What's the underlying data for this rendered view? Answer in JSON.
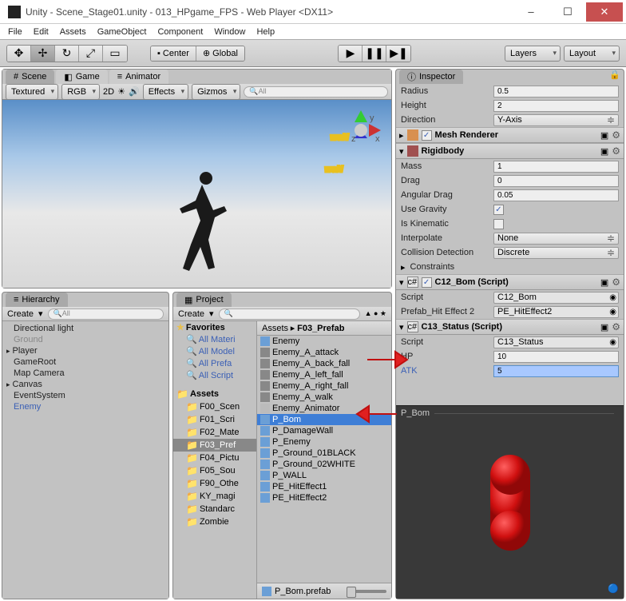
{
  "window": {
    "title": "Unity - Scene_Stage01.unity - 013_HPgame_FPS - Web Player <DX11>"
  },
  "menu": {
    "file": "File",
    "edit": "Edit",
    "assets": "Assets",
    "gameobject": "GameObject",
    "component": "Component",
    "window": "Window",
    "help": "Help"
  },
  "toolbar": {
    "center": "Center",
    "global": "Global",
    "layers": "Layers",
    "layout": "Layout"
  },
  "tabs": {
    "scene": "Scene",
    "game": "Game",
    "animator": "Animator",
    "hierarchy": "Hierarchy",
    "project": "Project",
    "inspector": "Inspector"
  },
  "scene_toolbar": {
    "textured": "Textured",
    "rgb": "RGB",
    "twod": "2D",
    "effects": "Effects",
    "gizmos": "Gizmos"
  },
  "hierarchy": {
    "create": "Create",
    "items": [
      "Directional light",
      "Ground",
      "Player",
      "GameRoot",
      "Map Camera",
      "Canvas",
      "EventSystem",
      "Enemy"
    ]
  },
  "project": {
    "create": "Create",
    "favorites": "Favorites",
    "fav_items": [
      "All Materi",
      "All Model",
      "All Prefa",
      "All Script"
    ],
    "assets_label": "Assets",
    "folders": [
      "F00_Scen",
      "F01_Scri",
      "F02_Mate",
      "F03_Pref",
      "F04_Pictu",
      "F05_Sou",
      "F90_Othe",
      "KY_magi",
      "Standarc",
      "Zombie"
    ],
    "breadcrumb_assets": "Assets",
    "breadcrumb_sep": "▸",
    "breadcrumb_folder": "F03_Prefab",
    "asset_items": [
      "Enemy",
      "Enemy_A_attack",
      "Enemy_A_back_fall",
      "Enemy_A_left_fall",
      "Enemy_A_right_fall",
      "Enemy_A_walk",
      "Enemy_Animator",
      "P_Bom",
      "P_DamageWall",
      "P_Enemy",
      "P_Ground_01BLACK",
      "P_Ground_02WHITE",
      "P_WALL",
      "PE_HitEffect1",
      "PE_HitEffect2"
    ],
    "footer": "P_Bom.prefab"
  },
  "inspector": {
    "radius_label": "Radius",
    "radius": "0.5",
    "height_label": "Height",
    "height": "2",
    "direction_label": "Direction",
    "direction": "Y-Axis",
    "mesh_renderer": "Mesh Renderer",
    "rigidbody": "Rigidbody",
    "mass_label": "Mass",
    "mass": "1",
    "drag_label": "Drag",
    "drag": "0",
    "angular_drag_label": "Angular Drag",
    "angular_drag": "0.05",
    "use_gravity_label": "Use Gravity",
    "is_kinematic_label": "Is Kinematic",
    "interpolate_label": "Interpolate",
    "interpolate": "None",
    "collision_label": "Collision Detection",
    "collision": "Discrete",
    "constraints_label": "Constraints",
    "c12_title": "C12_Bom (Script)",
    "script_label": "Script",
    "c12_script": "C12_Bom",
    "prefab_effect_label": "Prefab_Hit Effect 2",
    "prefab_effect": "PE_HitEffect2",
    "c13_title": "C13_Status (Script)",
    "c13_script": "C13_Status",
    "hp_label": "HP",
    "hp": "10",
    "atk_label": "ATK",
    "atk": "5",
    "preview_title": "P_Bom"
  }
}
